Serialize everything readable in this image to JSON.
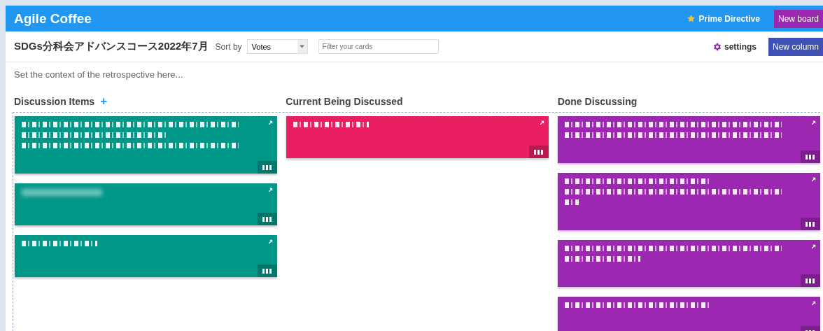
{
  "app_bar": {
    "title": "Agile Coffee",
    "prime_directive": "Prime Directive",
    "new_board": "New board"
  },
  "toolbar": {
    "board_name": "SDGs分科会アドバンスコース2022年7月",
    "sort_label": "Sort by",
    "sort_value": "Votes",
    "filter_placeholder": "Filter your cards",
    "settings": "settings",
    "new_column": "New column"
  },
  "context_placeholder": "Set the context of the retrospective here...",
  "columns": [
    {
      "title": "Discussion Items",
      "add_label": "+",
      "color": "#009688",
      "cards": [
        {
          "lines": [
            {
              "kind": "long"
            },
            {
              "kind": "medium"
            },
            {
              "kind": "long"
            }
          ]
        },
        {
          "lines": [
            {
              "kind": "blurred"
            }
          ]
        },
        {
          "lines": [
            {
              "kind": "short"
            }
          ]
        }
      ]
    },
    {
      "title": "Current Being Discussed",
      "color": "#e91e63",
      "cards": [
        {
          "lines": [
            {
              "kind": "short"
            }
          ]
        }
      ]
    },
    {
      "title": "Done Discussing",
      "color": "#9c27b0",
      "cards": [
        {
          "lines": [
            {
              "kind": "long"
            },
            {
              "kind": "long"
            }
          ]
        },
        {
          "lines": [
            {
              "kind": "medium"
            },
            {
              "kind": "long"
            },
            {
              "kind": "tiny"
            }
          ]
        },
        {
          "lines": [
            {
              "kind": "long"
            },
            {
              "kind": "short"
            }
          ]
        },
        {
          "lines": [
            {
              "kind": "medium"
            }
          ]
        }
      ]
    }
  ]
}
